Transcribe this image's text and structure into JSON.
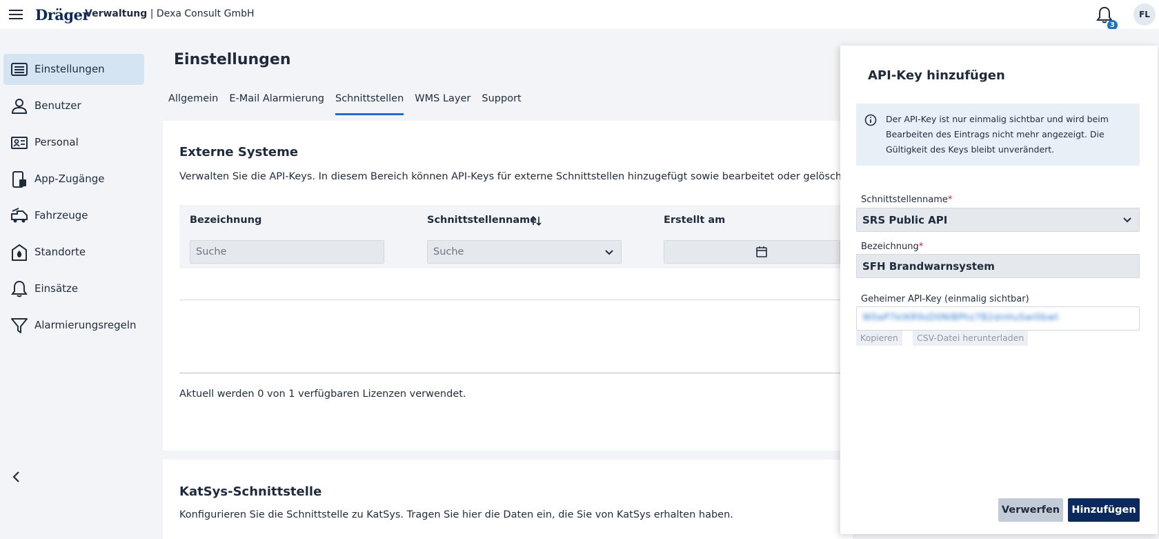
{
  "header": {
    "brand": "Dräger",
    "app_name": "Verwaltung",
    "separator": " | ",
    "org_name": "Dexa Consult GmbH",
    "notification_count": "3",
    "user_initials": "FL"
  },
  "sidebar": {
    "items": [
      {
        "label": "Einstellungen",
        "icon": "settings-panel-icon",
        "active": true
      },
      {
        "label": "Benutzer",
        "icon": "user-icon"
      },
      {
        "label": "Personal",
        "icon": "id-card-icon"
      },
      {
        "label": "App-Zugänge",
        "icon": "device-access-icon"
      },
      {
        "label": "Fahrzeuge",
        "icon": "fire-truck-icon"
      },
      {
        "label": "Standorte",
        "icon": "location-icon"
      },
      {
        "label": "Einsätze",
        "icon": "bell-icon"
      },
      {
        "label": "Alarmierungsregeln",
        "icon": "filter-icon"
      }
    ]
  },
  "page": {
    "title": "Einstellungen",
    "tabs": [
      {
        "label": "Allgemein"
      },
      {
        "label": "E-Mail Alarmierung"
      },
      {
        "label": "Schnittstellen",
        "active": true
      },
      {
        "label": "WMS Layer"
      },
      {
        "label": "Support"
      }
    ]
  },
  "external": {
    "title": "Externe Systeme",
    "description": "Verwalten Sie die API-Keys. In diesem Bereich können API-Keys für externe Schnittstellen hinzugefügt sowie bearbeitet oder gelöscht we",
    "columns": [
      "Bezeichnung",
      "Schnittstellenname",
      "Erstellt am"
    ],
    "filter_placeholder_1": "Suche",
    "filter_placeholder_2": "Suche",
    "license_text": "Aktuell werden 0 von 1 verfügbaren Lizenzen verwendet."
  },
  "katsys": {
    "title": "KatSys-Schnittstelle",
    "description": "Konfigurieren Sie die Schnittstelle zu KatSys. Tragen Sie hier die Daten ein, die Sie von KatSys erhalten haben."
  },
  "drawer": {
    "title": "API-Key hinzufügen",
    "info": "Der API-Key ist nur einmalig sichtbar und wird beim Bearbeiten des Eintrags nicht mehr angezeigt. Die Gültigkeit des Keys bleibt unverändert.",
    "field_interface_label": "Schnittstellenname",
    "field_interface_value": "SRS Public API",
    "field_name_label": "Bezeichnung",
    "field_name_value": "SFH Brandwarnsystem",
    "field_key_label": "Geheimer API-Key (einmalig sichtbar)",
    "required_mark": "*",
    "copy_label": "Kopieren",
    "csv_label": "CSV-Datei herunterladen",
    "discard_label": "Verwerfen",
    "add_label": "Hinzufügen"
  },
  "colors": {
    "primary": "#0b2a5b",
    "accent": "#1a72c9",
    "required": "#d0142c",
    "background": "#f2f4f7"
  }
}
